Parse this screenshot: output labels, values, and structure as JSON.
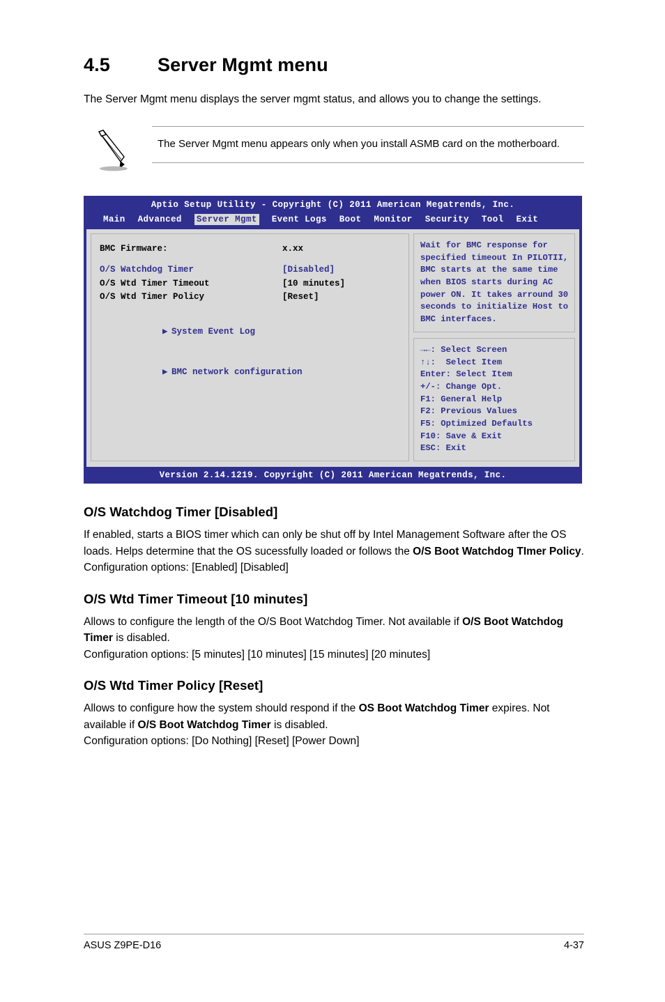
{
  "section": {
    "number": "4.5",
    "title": "Server Mgmt menu",
    "intro": "The Server Mgmt menu displays the server mgmt status, and allows you to change the settings."
  },
  "note": {
    "text": "The Server Mgmt menu appears only when you install ASMB card on the motherboard."
  },
  "bios": {
    "titlebar": "Aptio Setup Utility - Copyright (C) 2011 American Megatrends, Inc.",
    "menu": [
      "Main",
      "Advanced",
      "Server Mgmt",
      "Event Logs",
      "Boot",
      "Monitor",
      "Security",
      "Tool",
      "Exit"
    ],
    "active_menu": "Server Mgmt",
    "items": [
      {
        "label": "BMC Firmware:",
        "value": "x.xx",
        "style": "bold"
      },
      {
        "label": "O/S Watchdog Timer",
        "value": "[Disabled]",
        "style": "blue"
      },
      {
        "label": "O/S Wtd Timer Timeout",
        "value": "[10 minutes]",
        "style": "bold"
      },
      {
        "label": "O/S Wtd Timer Policy",
        "value": "[Reset]",
        "style": "bold"
      }
    ],
    "submenus": [
      "System Event Log",
      "BMC network configuration"
    ],
    "help": "Wait for BMC response for specified timeout In PILOTII, BMC starts at the same time when BIOS starts during AC power ON. It takes arround 30 seconds to initialize Host to BMC interfaces.",
    "keys": [
      "→←: Select Screen",
      "↑↓:  Select Item",
      "Enter: Select Item",
      "+/-: Change Opt.",
      "F1: General Help",
      "F2: Previous Values",
      "F5: Optimized Defaults",
      "F10: Save & Exit",
      "ESC: Exit"
    ],
    "footer": "Version 2.14.1219. Copyright (C) 2011 American Megatrends, Inc."
  },
  "options": [
    {
      "heading": "O/S Watchdog Timer [Disabled]",
      "desc_html": "If enabled, starts a BIOS timer which can only be shut off by Intel Management Software after the OS loads. Helps determine that the OS sucessfully loaded or follows the <b>O/S Boot Watchdog TImer Policy</b>.<br>Configuration options: [Enabled] [Disabled]"
    },
    {
      "heading": "O/S Wtd Timer Timeout [10 minutes]",
      "desc_html": "Allows to configure the length of the O/S Boot Watchdog Timer. Not available if <b>O/S Boot Watchdog Timer</b> is disabled.<br>Configuration options: [5 minutes] [10 minutes] [15 minutes] [20 minutes]"
    },
    {
      "heading": "O/S Wtd Timer Policy [Reset]",
      "desc_html": "Allows to configure how the system should respond if the <b>OS Boot Watchdog Timer</b> expires. Not available if <b>O/S Boot Watchdog Timer</b> is disabled.<br>Configuration options: [Do Nothing] [Reset] [Power Down]"
    }
  ],
  "footer": {
    "left": "ASUS Z9PE-D16",
    "right": "4-37"
  }
}
